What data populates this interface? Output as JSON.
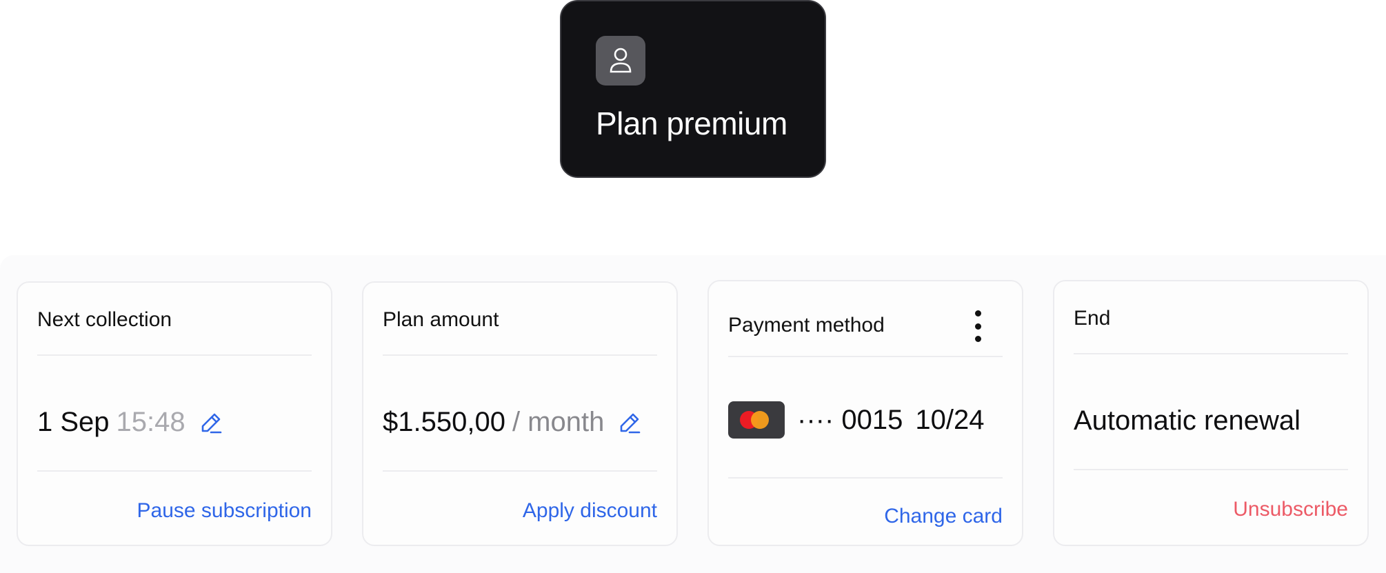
{
  "plan": {
    "title": "Plan premium",
    "icon": "user-icon"
  },
  "cards": {
    "next_collection": {
      "title": "Next collection",
      "date": "1 Sep",
      "time": "15:48",
      "action": "Pause subscription"
    },
    "plan_amount": {
      "title": "Plan amount",
      "amount": "$1.550,00",
      "period": "/ month",
      "action": "Apply discount"
    },
    "payment_method": {
      "title": "Payment method",
      "card_brand_icon": "mastercard-icon",
      "masked_number": "···· 0015",
      "expiry": "10/24",
      "action": "Change card"
    },
    "end": {
      "title": "End",
      "value": "Automatic renewal",
      "action": "Unsubscribe"
    }
  },
  "colors": {
    "accent": "#2f66e8",
    "danger": "#ec5a66",
    "plan_card_bg": "#121215"
  }
}
